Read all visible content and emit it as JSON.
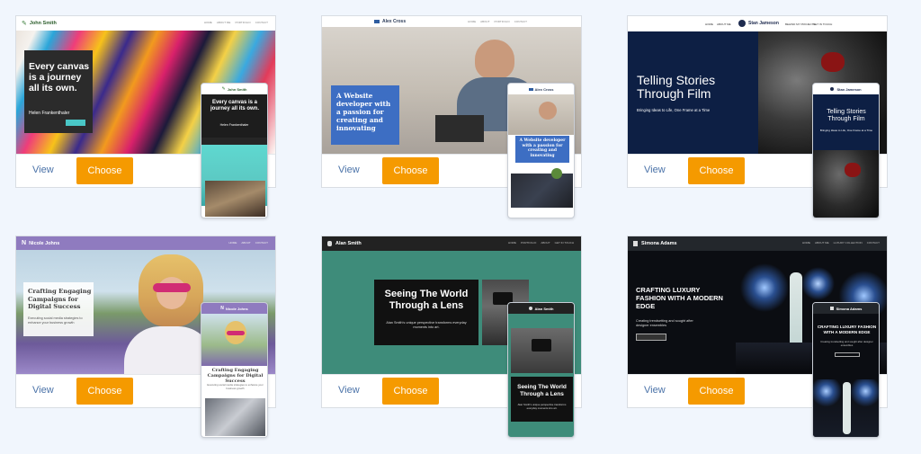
{
  "common": {
    "view_label": "View",
    "choose_label": "Choose"
  },
  "templates": [
    {
      "brand": "John Smith",
      "nav": [
        "HOME",
        "ABOUT ME",
        "PORTFOLIO",
        "CONTACT"
      ],
      "headline": "Every canvas is a journey all its own.",
      "subline": "Helen Frankenthaler"
    },
    {
      "brand": "Alex Cross",
      "nav": [
        "HOME",
        "ABOUT",
        "PORTFOLIO",
        "CONTACT"
      ],
      "headline": "A Website developer with a passion for creating and innovating"
    },
    {
      "brand": "Stan Jameson",
      "nav_left": [
        "HOME",
        "ABOUT ME"
      ],
      "nav_right": [
        "BEHIND MY PROJECTS",
        "GET IN TOUCH"
      ],
      "headline": "Telling Stories Through Film",
      "subline": "Bringing Ideas to Life, One Frame at a Time"
    },
    {
      "brand": "Nicole Johns",
      "nav": [
        "HOME",
        "ABOUT",
        "CONTACT"
      ],
      "headline": "Crafting Engaging Campaigns for Digital Success",
      "subline": "Executing social media strategies to enhance your business growth"
    },
    {
      "brand": "Alan Smith",
      "nav": [
        "HOME",
        "PORTFOLIO",
        "ABOUT",
        "GET IN TOUCH"
      ],
      "headline": "Seeing The World Through a Lens",
      "subline": "Alan Smith's unique perspective transforms everyday moments into art."
    },
    {
      "brand": "Simona Adams",
      "nav": [
        "HOME",
        "ABOUT ME",
        "LUXURY COLLECTION",
        "CONTACT"
      ],
      "headline": "CRAFTING LUXURY FASHION WITH A MODERN EDGE",
      "subline": "Creating trendsetting and sought after designer ensembles"
    }
  ]
}
